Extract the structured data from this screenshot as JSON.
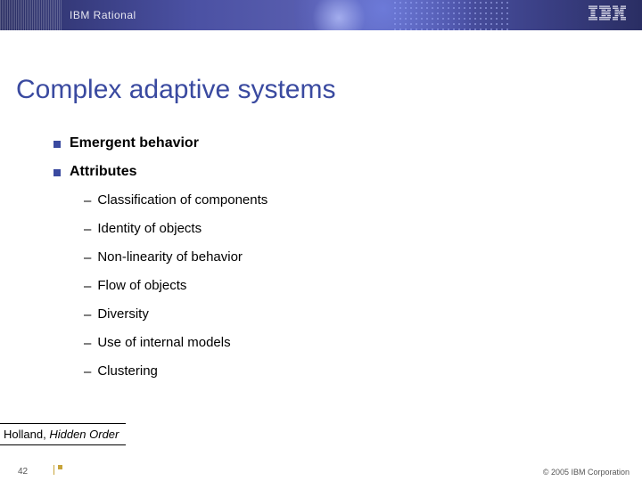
{
  "header": {
    "product_line": "IBM Rational",
    "logo_label": "IBM"
  },
  "title": "Complex adaptive systems",
  "bullets": [
    {
      "text": "Emergent behavior",
      "children": []
    },
    {
      "text": "Attributes",
      "children": [
        "Classification of components",
        "Identity of objects",
        "Non-linearity of behavior",
        "Flow of objects",
        "Diversity",
        "Use of internal models",
        "Clustering"
      ]
    }
  ],
  "citation": {
    "author": "Holland,",
    "title_italic": "Hidden Order"
  },
  "footer": {
    "page_number": "42",
    "copyright": "© 2005 IBM Corporation"
  }
}
